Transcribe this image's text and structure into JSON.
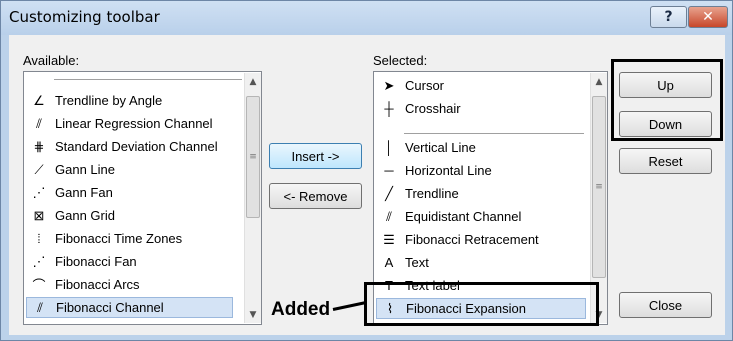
{
  "window": {
    "title": "Customizing toolbar",
    "help_button": "?",
    "close_button": "✕"
  },
  "available": {
    "label": "Available:",
    "items": [
      {
        "label": "Trendline by Angle",
        "icon": "trendline-angle-icon",
        "glyph": "∠"
      },
      {
        "label": "Linear Regression Channel",
        "icon": "linear-regression-icon",
        "glyph": "⫽"
      },
      {
        "label": "Standard Deviation Channel",
        "icon": "std-deviation-icon",
        "glyph": "⋕"
      },
      {
        "label": "Gann Line",
        "icon": "gann-line-icon",
        "glyph": "⟋"
      },
      {
        "label": "Gann Fan",
        "icon": "gann-fan-icon",
        "glyph": "⋰"
      },
      {
        "label": "Gann Grid",
        "icon": "gann-grid-icon",
        "glyph": "⊠"
      },
      {
        "label": "Fibonacci Time Zones",
        "icon": "fibo-time-zones-icon",
        "glyph": "⦙"
      },
      {
        "label": "Fibonacci Fan",
        "icon": "fibo-fan-icon",
        "glyph": "⋰"
      },
      {
        "label": "Fibonacci Arcs",
        "icon": "fibo-arcs-icon",
        "glyph": "⌒"
      },
      {
        "label": "Fibonacci Channel",
        "icon": "fibo-channel-icon",
        "glyph": "⫽",
        "selected": true
      }
    ]
  },
  "selected": {
    "label": "Selected:",
    "items": [
      {
        "label": "Cursor",
        "icon": "cursor-arrow-icon",
        "glyph": "➤"
      },
      {
        "label": "Crosshair",
        "icon": "crosshair-icon",
        "glyph": "┼"
      },
      {
        "separator": true
      },
      {
        "label": "Vertical Line",
        "icon": "vertical-line-icon",
        "glyph": "│"
      },
      {
        "label": "Horizontal Line",
        "icon": "horizontal-line-icon",
        "glyph": "─"
      },
      {
        "label": "Trendline",
        "icon": "trendline-icon",
        "glyph": "╱"
      },
      {
        "label": "Equidistant Channel",
        "icon": "equidistant-channel-icon",
        "glyph": "⫽"
      },
      {
        "label": "Fibonacci Retracement",
        "icon": "fibo-retracement-icon",
        "glyph": "☰"
      },
      {
        "label": "Text",
        "icon": "text-icon",
        "glyph": "A"
      },
      {
        "label": "Text label",
        "icon": "text-label-icon",
        "glyph": "T"
      },
      {
        "label": "Fibonacci Expansion",
        "icon": "fibo-expansion-icon",
        "glyph": "⌇",
        "selected": true
      }
    ]
  },
  "buttons": {
    "insert": "Insert ->",
    "remove": "<- Remove",
    "up": "Up",
    "down": "Down",
    "reset": "Reset",
    "close": "Close"
  },
  "annotation": {
    "added": "Added"
  }
}
